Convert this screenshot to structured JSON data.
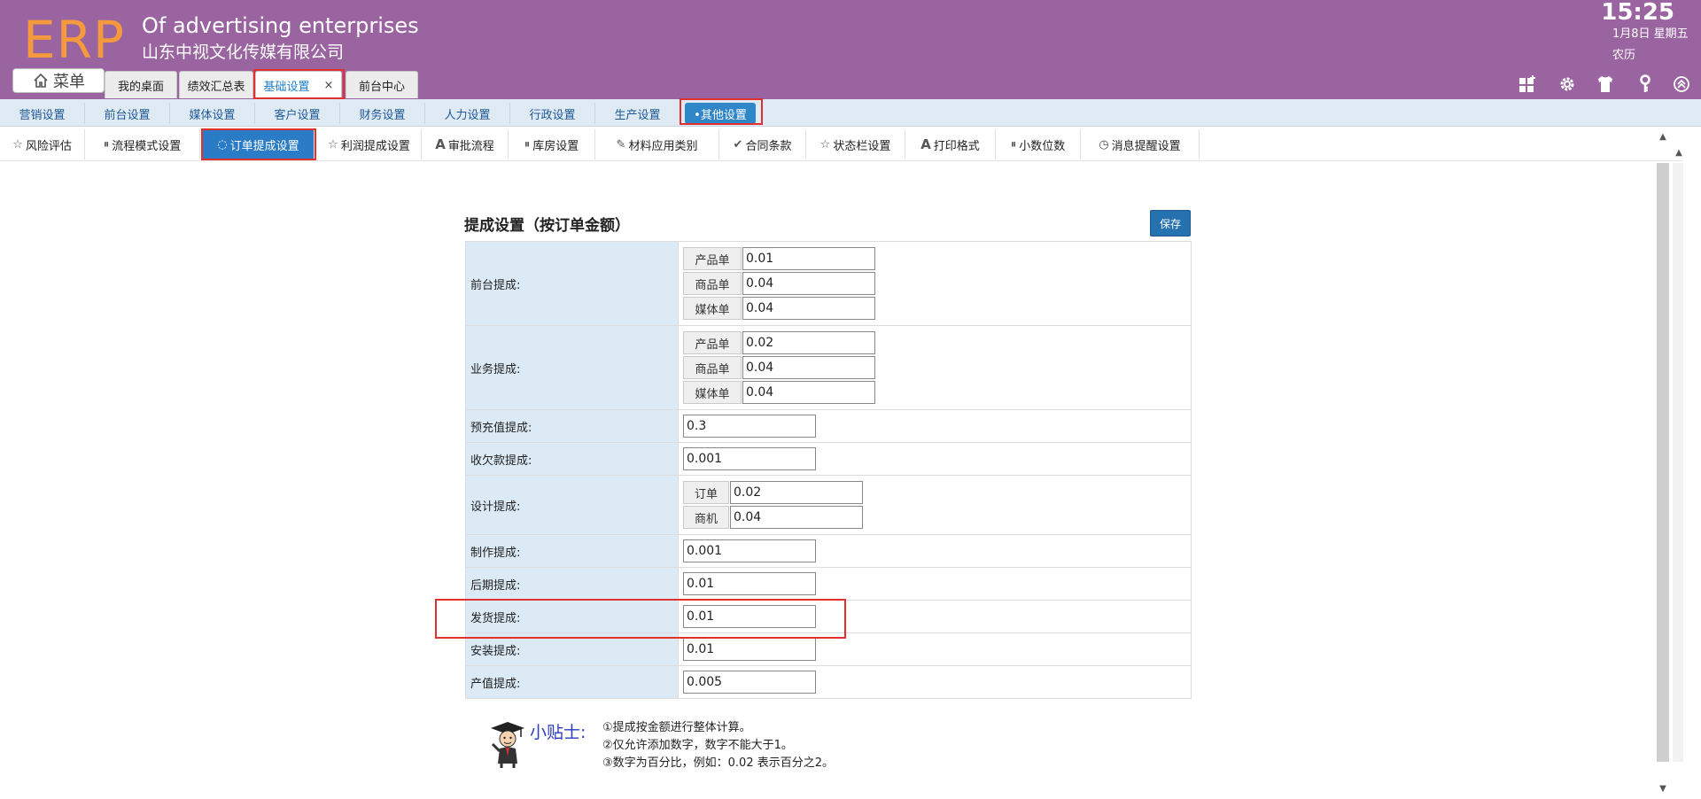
{
  "header": {
    "logo": "ERP",
    "company_en": "Of advertising enterprises",
    "company_cn": "山东中视文化传媒有限公司",
    "time": "15:25",
    "date": "1月8日 星期五",
    "lunar": "农历",
    "menu_label": "菜单",
    "tabs": [
      {
        "label": "我的桌面"
      },
      {
        "label": "绩效汇总表"
      },
      {
        "label": "基础设置",
        "close": "×"
      },
      {
        "label": "前台中心"
      }
    ]
  },
  "nav2": {
    "items": [
      {
        "label": "营销设置"
      },
      {
        "label": "前台设置"
      },
      {
        "label": "媒体设置"
      },
      {
        "label": "客户设置"
      },
      {
        "label": "财务设置"
      },
      {
        "label": "人力设置"
      },
      {
        "label": "行政设置"
      },
      {
        "label": "生产设置"
      },
      {
        "label": "•其他设置"
      }
    ]
  },
  "nav3": {
    "items": [
      {
        "label": "风险评估",
        "icon": "star-icon"
      },
      {
        "label": "流程模式设置",
        "icon": "pause-circle-icon"
      },
      {
        "label": "订单提成设置",
        "icon": "circle-icon"
      },
      {
        "label": "利润提成设置",
        "icon": "star-icon"
      },
      {
        "label": "审批流程",
        "icon": "font-icon"
      },
      {
        "label": "库房设置",
        "icon": "pause-circle-icon"
      },
      {
        "label": "材料应用类别",
        "icon": "pencil-icon"
      },
      {
        "label": "合同条款",
        "icon": "check-icon"
      },
      {
        "label": "状态栏设置",
        "icon": "star-icon"
      },
      {
        "label": "打印格式",
        "icon": "font-icon"
      },
      {
        "label": "小数位数",
        "icon": "pause-circle-icon"
      },
      {
        "label": "消息提醒设置",
        "icon": "clock-icon"
      }
    ]
  },
  "panel": {
    "title": "提成设置（按订单金额）",
    "save_label": "保存",
    "rows": {
      "front": {
        "label": "前台提成:",
        "sub": [
          {
            "tag": "产品单",
            "value": "0.01"
          },
          {
            "tag": "商品单",
            "value": "0.04"
          },
          {
            "tag": "媒体单",
            "value": "0.04"
          }
        ]
      },
      "business": {
        "label": "业务提成:",
        "sub": [
          {
            "tag": "产品单",
            "value": "0.02"
          },
          {
            "tag": "商品单",
            "value": "0.04"
          },
          {
            "tag": "媒体单",
            "value": "0.04"
          }
        ]
      },
      "prepaid": {
        "label": "预充值提成:",
        "value": "0.3"
      },
      "arrears": {
        "label": "收欠款提成:",
        "value": "0.001"
      },
      "design": {
        "label": "设计提成:",
        "sub": [
          {
            "tag": "订单",
            "value": "0.02"
          },
          {
            "tag": "商机",
            "value": "0.04"
          }
        ]
      },
      "production": {
        "label": "制作提成:",
        "value": "0.001"
      },
      "post": {
        "label": "后期提成:",
        "value": "0.01"
      },
      "shipping": {
        "label": "发货提成:",
        "value": "0.01"
      },
      "install": {
        "label": "安装提成:",
        "value": "0.01"
      },
      "output": {
        "label": "产值提成:",
        "value": "0.005"
      }
    }
  },
  "tips": {
    "title": "小贴士:",
    "lines": [
      "①提成按金额进行整体计算。",
      "②仅允许添加数字，数字不能大于1。",
      "③数字为百分比，例如：0.02 表示百分之2。"
    ]
  },
  "colors": {
    "header_bg": "#9a64a0",
    "logo": "#f59a3c",
    "nav2_bg": "#dfeaf4",
    "active_blue": "#2a7cc6",
    "label_bg": "#dbeaf5",
    "highlight_red": "#e03030"
  }
}
